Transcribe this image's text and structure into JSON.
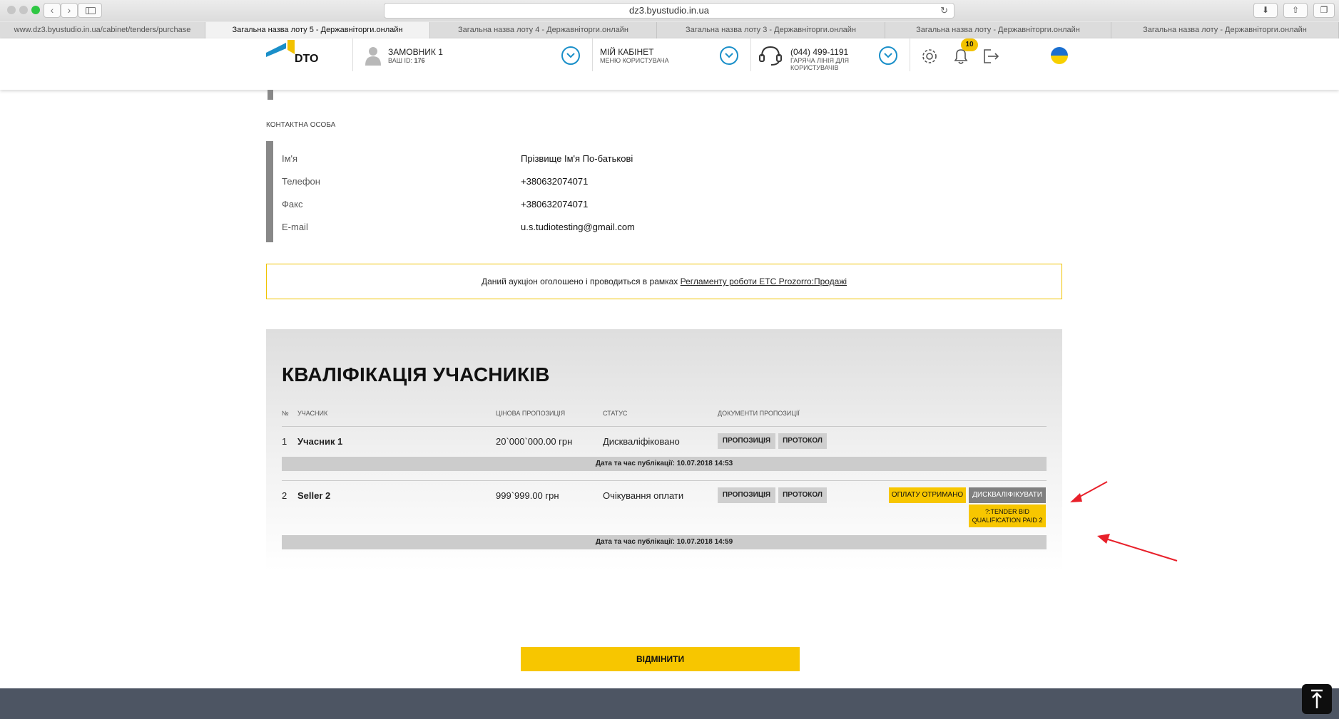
{
  "browser": {
    "url": "dz3.byustudio.in.ua",
    "tabs": [
      {
        "label": "www.dz3.byustudio.in.ua/cabinet/tenders/purchase",
        "active": false
      },
      {
        "label": "Загальна назва лоту 5 - Державніторги.онлайн",
        "active": true
      },
      {
        "label": "Загальна назва лоту 4 - Державніторги.онлайн",
        "active": false
      },
      {
        "label": "Загальна назва лоту 3 - Державніторги.онлайн",
        "active": false
      },
      {
        "label": "Загальна назва лоту - Державніторги.онлайн",
        "active": false
      },
      {
        "label": "Загальна назва лоту - Державніторги.онлайн",
        "active": false
      }
    ]
  },
  "header": {
    "logo": "DTO",
    "user_name": "ЗАМОВНИК 1",
    "user_id_label": "ВАШ ID:",
    "user_id": "176",
    "cabinet_title": "МІЙ КАБІНЕТ",
    "cabinet_sub": "МЕНЮ КОРИСТУВАЧА",
    "hotline_phone": "(044) 499-1191",
    "hotline_sub": "ГАРЯЧА ЛІНІЯ ДЛЯ КОРИСТУВАЧІВ",
    "notifications_count": "10"
  },
  "contact": {
    "section_label": "КОНТАКТНА ОСОБА",
    "rows": [
      {
        "key": "Ім'я",
        "value": "Прізвище Ім'я По-батькові"
      },
      {
        "key": "Телефон",
        "value": "+380632074071"
      },
      {
        "key": "Факс",
        "value": "+380632074071"
      },
      {
        "key": "E-mail",
        "value": "u.s.tudiotesting@gmail.com"
      }
    ]
  },
  "notice": {
    "text": "Даний аукціон оголошено і проводиться в рамках ",
    "link": "Регламенту роботи ЕТС Prozorro:Продажі"
  },
  "qualification": {
    "title": "КВАЛІФІКАЦІЯ УЧАСНИКІВ",
    "headers": {
      "num": "№",
      "participant": "УЧАСНИК",
      "price": "ЦІНОВА ПРОПОЗИЦІЯ",
      "status": "СТАТУС",
      "docs": "ДОКУМЕНТИ ПРОПОЗИЦІЇ"
    },
    "rows": [
      {
        "num": "1",
        "participant": "Учасник 1",
        "price": "20`000`000.00 грн",
        "status": "Дискваліфіковано",
        "doc1": "ПРОПОЗИЦІЯ",
        "doc2": "ПРОТОКОЛ",
        "published": "Дата та час публікації: 10.07.2018 14:53"
      },
      {
        "num": "2",
        "participant": "Seller 2",
        "price": "999`999.00 грн",
        "status": "Очікування оплати",
        "doc1": "ПРОПОЗИЦІЯ",
        "doc2": "ПРОТОКОЛ",
        "published": "Дата та час публікації: 10.07.2018 14:59"
      }
    ],
    "actions": {
      "paid": "ОПЛАТУ ОТРИМАНО",
      "disqualify": "ДИСКВАЛІФІКУВАТИ",
      "tag_line1": "?:TENDER BID",
      "tag_line2": "QUALIFICATION PAID 2"
    }
  },
  "cancel_button": "ВІДМІНИТИ",
  "colors": {
    "accent": "#f7c600",
    "blue": "#1a8fc9",
    "footer": "#4d5563",
    "annotation_arrow": "#e8202a"
  }
}
